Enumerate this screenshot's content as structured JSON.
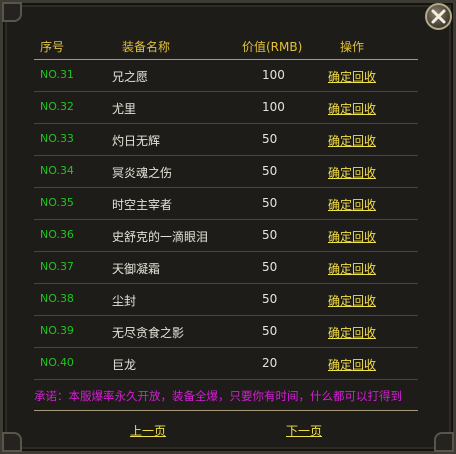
{
  "header": {
    "col_no": "序号",
    "col_name": "装备名称",
    "col_price": "价值(RMB)",
    "col_action": "操作"
  },
  "rows": [
    {
      "no": "NO.31",
      "name": "兄之愿",
      "price": "100",
      "action": "确定回收"
    },
    {
      "no": "NO.32",
      "name": "尤里",
      "price": "100",
      "action": "确定回收"
    },
    {
      "no": "NO.33",
      "name": "灼日无辉",
      "price": "50",
      "action": "确定回收"
    },
    {
      "no": "NO.34",
      "name": "冥炎魂之伤",
      "price": "50",
      "action": "确定回收"
    },
    {
      "no": "NO.35",
      "name": "时空主宰者",
      "price": "50",
      "action": "确定回收"
    },
    {
      "no": "NO.36",
      "name": "史舒克的一滴眼泪",
      "price": "50",
      "action": "确定回收"
    },
    {
      "no": "NO.37",
      "name": "天御凝霜",
      "price": "50",
      "action": "确定回收"
    },
    {
      "no": "NO.38",
      "name": "尘封",
      "price": "50",
      "action": "确定回收"
    },
    {
      "no": "NO.39",
      "name": "无尽贪食之影",
      "price": "50",
      "action": "确定回收"
    },
    {
      "no": "NO.40",
      "name": "巨龙",
      "price": "20",
      "action": "确定回收"
    }
  ],
  "notice": "承诺：本服爆率永久开放，装备全爆，只要你有时间，什么都可以打得到",
  "pager": {
    "prev": "上一页",
    "next": "下一页"
  },
  "colors": {
    "header": "#e2c23c",
    "number": "#1fc51f",
    "action": "#f0e04a",
    "notice": "#d41ed4"
  },
  "icons": {
    "close": "close-icon"
  }
}
